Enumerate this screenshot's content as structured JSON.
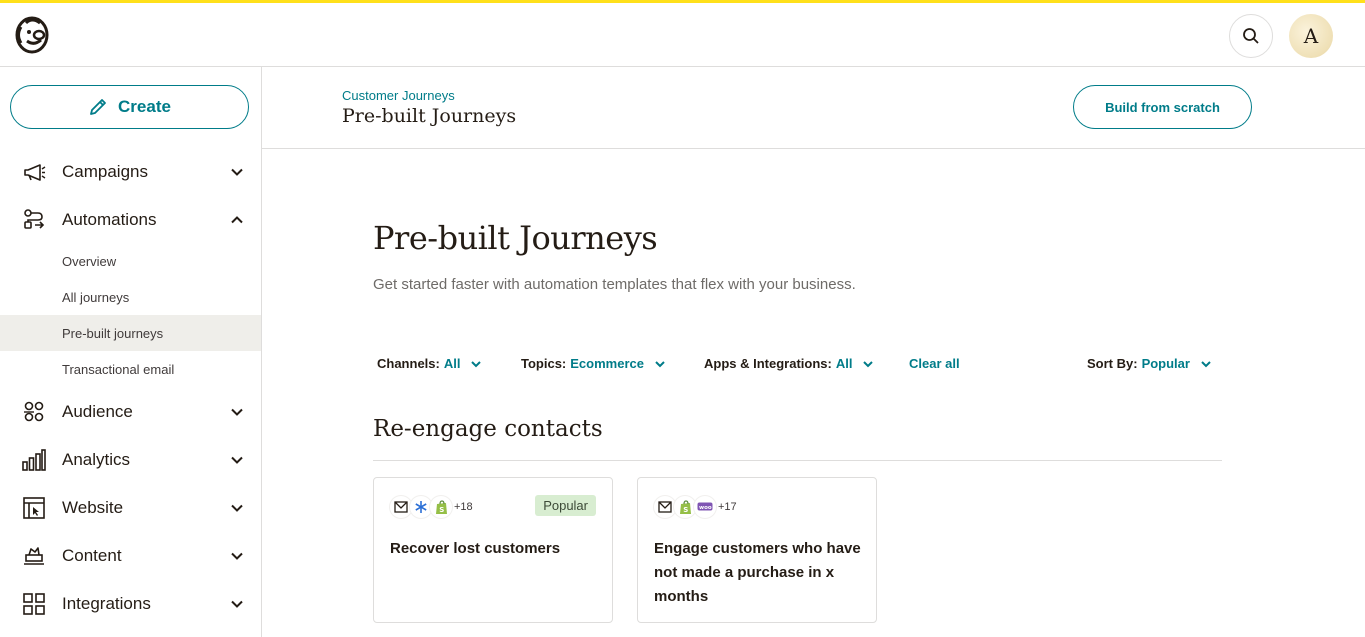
{
  "topbar": {
    "logo": "mailchimp-freddie-logo",
    "search_icon": "search-icon",
    "avatar_initial": "A"
  },
  "sidebar": {
    "create_label": "Create",
    "items": [
      {
        "label": "Campaigns",
        "icon": "megaphone-icon",
        "expanded": false
      },
      {
        "label": "Automations",
        "icon": "flow-icon",
        "expanded": true
      },
      {
        "label": "Audience",
        "icon": "people-icon",
        "expanded": false
      },
      {
        "label": "Analytics",
        "icon": "bar-chart-icon",
        "expanded": false
      },
      {
        "label": "Website",
        "icon": "website-icon",
        "expanded": false
      },
      {
        "label": "Content",
        "icon": "content-icon",
        "expanded": false
      },
      {
        "label": "Integrations",
        "icon": "grid-icon",
        "expanded": false
      }
    ],
    "automations_sub": [
      {
        "label": "Overview"
      },
      {
        "label": "All journeys"
      },
      {
        "label": "Pre-built journeys",
        "active": true
      },
      {
        "label": "Transactional email"
      }
    ]
  },
  "header": {
    "breadcrumb": "Customer Journeys",
    "title": "Pre-built Journeys",
    "build_button": "Build from scratch"
  },
  "main": {
    "title": "Pre-built Journeys",
    "subtitle": "Get started faster with automation templates that flex with your business.",
    "filters": {
      "channels": {
        "label": "Channels:",
        "value": "All"
      },
      "topics": {
        "label": "Topics:",
        "value": "Ecommerce"
      },
      "apps": {
        "label": "Apps & Integrations:",
        "value": "All"
      },
      "clear": "Clear all",
      "sort": {
        "label": "Sort By:",
        "value": "Popular"
      }
    },
    "section_title": "Re-engage contacts",
    "cards": [
      {
        "title": "Recover lost customers",
        "icons": [
          "email-icon",
          "snowflake-icon",
          "shopify-icon"
        ],
        "more": "+18",
        "badge": "Popular"
      },
      {
        "title": "Engage customers who have not made a purchase in x months",
        "icons": [
          "email-icon",
          "shopify-icon",
          "woo-icon"
        ],
        "more": "+17",
        "badge": ""
      }
    ]
  },
  "colors": {
    "accent": "#007c89",
    "brand_yellow": "#ffe01b",
    "active_bg": "#efeeea",
    "badge_bg": "#d8edd1"
  }
}
